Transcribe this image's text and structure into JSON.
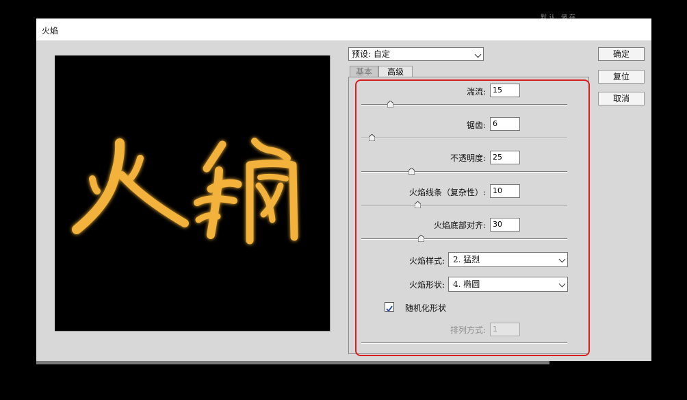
{
  "window": {
    "title": "火焰",
    "background_text": "默认 储存"
  },
  "preset": {
    "label": "预设:",
    "value": "自定"
  },
  "tabs": [
    {
      "label": "基本",
      "active": false
    },
    {
      "label": "高级",
      "active": true
    }
  ],
  "advanced": {
    "turbulence": {
      "label": "湍流:",
      "value": "15",
      "slider_fraction": 0.14
    },
    "jaggedness": {
      "label": "锯齿:",
      "value": "6",
      "slider_fraction": 0.05
    },
    "opacity": {
      "label": "不透明度:",
      "value": "25",
      "slider_fraction": 0.24
    },
    "flame_lines": {
      "label": "火焰线条（复杂性）:",
      "value": "10",
      "slider_fraction": 0.28
    },
    "flame_bottom_align": {
      "label": "火焰底部对齐:",
      "value": "30",
      "slider_fraction": 0.29
    },
    "flame_style": {
      "label": "火焰样式:",
      "value": "2. 猛烈"
    },
    "flame_shape": {
      "label": "火焰形状:",
      "value": "4. 椭圆"
    },
    "randomize_shapes": {
      "label": "随机化形状",
      "checked": true
    },
    "arrangement": {
      "label": "排列方式:",
      "value": "1",
      "enabled": false
    }
  },
  "buttons": {
    "ok": "确定",
    "reset": "复位",
    "cancel": "取消"
  },
  "colors": {
    "highlight": "#d81e1e",
    "flame": "#f2b23a"
  }
}
